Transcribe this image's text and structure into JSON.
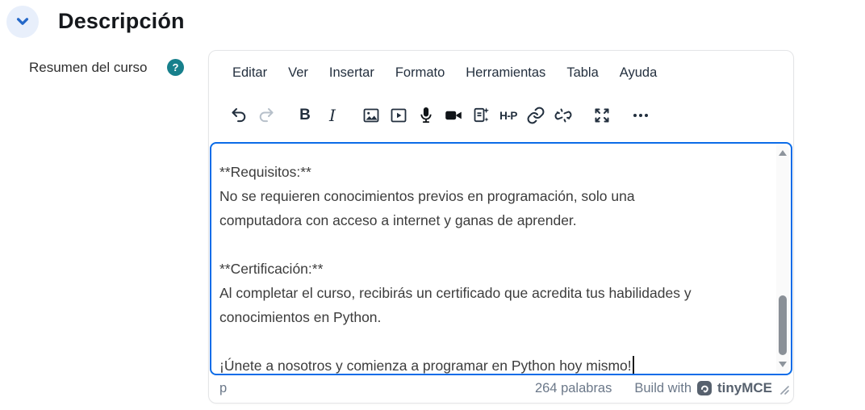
{
  "section": {
    "title": "Descripción"
  },
  "field": {
    "label": "Resumen del curso",
    "help_char": "?"
  },
  "editor": {
    "menubar": {
      "items": [
        "Editar",
        "Ver",
        "Insertar",
        "Formato",
        "Herramientas",
        "Tabla",
        "Ayuda"
      ]
    },
    "toolbar": {
      "icons": [
        "undo-icon",
        "redo-icon",
        "bold-icon",
        "italic-icon",
        "image-icon",
        "media-icon",
        "microphone-icon",
        "video-camera-icon",
        "ai-generate-document-icon",
        "h5p-icon",
        "link-icon",
        "unlink-icon",
        "fullscreen-icon",
        "more-icon"
      ],
      "bold_label": "B",
      "italic_label": "I",
      "h5p_label": "H-P"
    },
    "content": {
      "lines": [
        "**Requisitos:**",
        "No se requieren conocimientos previos en programación, solo una",
        "computadora con acceso a internet y ganas de aprender.",
        "",
        "**Certificación:**",
        "Al completar el curso, recibirás un certificado que acredita tus habilidades y",
        "conocimientos en Python.",
        "",
        "¡Únete a nosotros y comienza a programar en Python hoy mismo!"
      ]
    },
    "statusbar": {
      "element_path": "p",
      "word_count": "264 palabras",
      "branding_text": "Build with",
      "branding_logo_text": "tinyMCE"
    }
  },
  "colors": {
    "focus_border_blue": "#0b6ce8",
    "collapse_button_bg": "#e8effb",
    "collapse_chevron_blue": "#2468c8",
    "help_icon_teal": "#17808c",
    "toolbar_icon": "#222f3e",
    "disabled_icon": "#b7c0ca",
    "status_text_gray": "#6b7889",
    "content_text": "#3c3c3c"
  }
}
